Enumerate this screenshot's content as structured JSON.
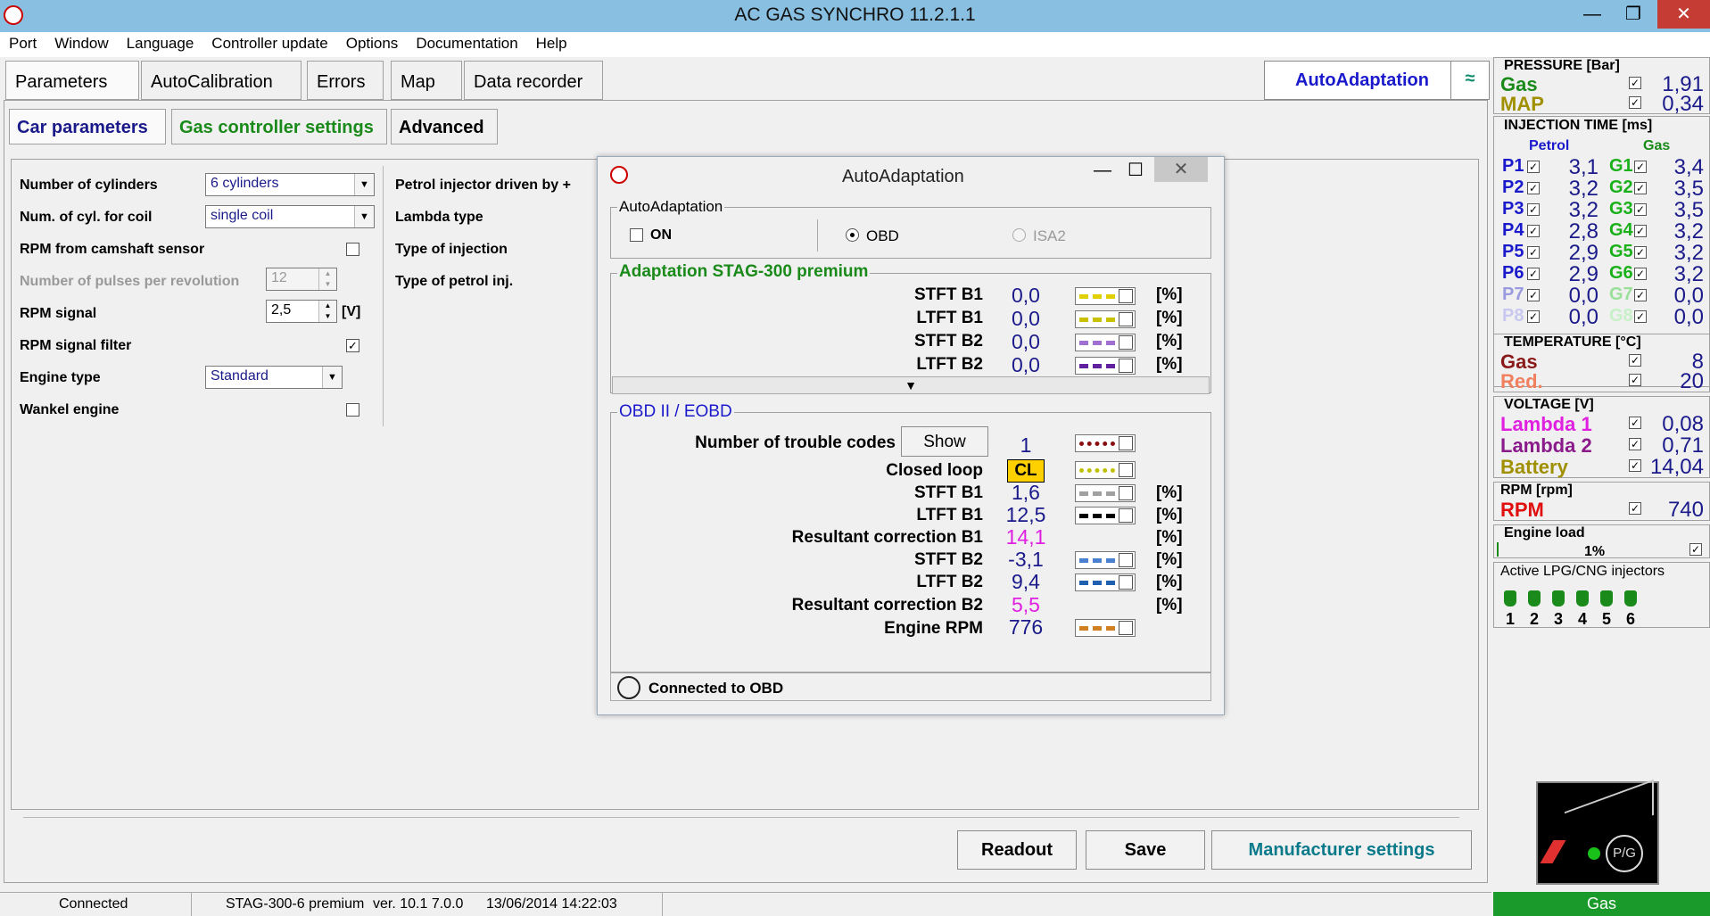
{
  "app": {
    "title": "AC GAS SYNCHRO  11.2.1.1"
  },
  "menu": [
    "Port",
    "Window",
    "Language",
    "Controller update",
    "Options",
    "Documentation",
    "Help"
  ],
  "tabs": [
    "Parameters",
    "AutoCalibration",
    "Errors",
    "Map",
    "Data recorder"
  ],
  "autoadapt_button": "AutoAdaptation",
  "subtabs": [
    "Car parameters",
    "Gas controller settings",
    "Advanced"
  ],
  "car": {
    "num_cyl_label": "Number of cylinders",
    "num_cyl_value": "6 cylinders",
    "coil_label": "Num. of cyl. for coil",
    "coil_value": "single coil",
    "camshaft_label": "RPM from camshaft sensor",
    "pulses_label": "Number of pulses per revolution",
    "pulses_value": "12",
    "rpm_signal_label": "RPM signal",
    "rpm_signal_value": "2,5",
    "rpm_signal_unit": "[V]",
    "filter_label": "RPM signal filter",
    "engine_type_label": "Engine type",
    "engine_type_value": "Standard",
    "wankel_label": "Wankel engine",
    "petrol_driven_label": "Petrol injector driven by +",
    "lambda_type_label": "Lambda type",
    "injection_type_label": "Type of injection",
    "petrol_inj_label": "Type of petrol inj."
  },
  "dialog": {
    "title": "AutoAdaptation",
    "group1": "AutoAdaptation",
    "on": "ON",
    "obd": "OBD",
    "isa2": "ISA2",
    "group2": "Adaptation STAG-300 premium",
    "adapt_rows": [
      {
        "label": "STFT B1",
        "value": "0,0",
        "unit": "[%]",
        "color": "#e0d000"
      },
      {
        "label": "LTFT B1",
        "value": "0,0",
        "unit": "[%]",
        "color": "#c8c000"
      },
      {
        "label": "STFT B2",
        "value": "0,0",
        "unit": "[%]",
        "color": "#a070d0"
      },
      {
        "label": "LTFT B2",
        "value": "0,0",
        "unit": "[%]",
        "color": "#6020a0"
      }
    ],
    "group3": "OBD II / EOBD",
    "trouble_label": "Number of trouble codes",
    "show_button": "Show",
    "trouble_value": "1",
    "closed_loop_label": "Closed loop",
    "closed_loop_value": "CL",
    "obd_rows": [
      {
        "label": "STFT B1",
        "value": "1,6",
        "unit": "[%]",
        "color": "#a0a0a0"
      },
      {
        "label": "LTFT B1",
        "value": "12,5",
        "unit": "[%]",
        "color": "#000000"
      },
      {
        "label": "Resultant correction B1",
        "value": "14,1",
        "unit": "[%]",
        "color": ""
      },
      {
        "label": "STFT B2",
        "value": "-3,1",
        "unit": "[%]",
        "color": "#4a80d0"
      },
      {
        "label": "LTFT B2",
        "value": "9,4",
        "unit": "[%]",
        "color": "#2060b0"
      },
      {
        "label": "Resultant correction B2",
        "value": "5,5",
        "unit": "[%]",
        "color": ""
      },
      {
        "label": "Engine RPM",
        "value": "776",
        "unit": "",
        "color": "#d08020"
      }
    ],
    "connected": "Connected to OBD"
  },
  "buttons": {
    "readout": "Readout",
    "save": "Save",
    "manufacturer": "Manufacturer settings"
  },
  "status": {
    "connected": "Connected",
    "device": "STAG-300-6 premium",
    "version": "ver. 10.1  7.0.0",
    "date": "13/06/2014 14:22:03"
  },
  "right": {
    "pressure_header": "PRESSURE [Bar]",
    "gas_label": "Gas",
    "gas_value": "1,91",
    "map_label": "MAP",
    "map_value": "0,34",
    "inj_header": "INJECTION TIME [ms]",
    "petrol_header": "Petrol",
    "gas_header": "Gas",
    "inj_rows": [
      {
        "p": "P1",
        "pv": "3,1",
        "g": "G1",
        "gv": "3,4"
      },
      {
        "p": "P2",
        "pv": "3,2",
        "g": "G2",
        "gv": "3,5"
      },
      {
        "p": "P3",
        "pv": "3,2",
        "g": "G3",
        "gv": "3,5"
      },
      {
        "p": "P4",
        "pv": "2,8",
        "g": "G4",
        "gv": "3,2"
      },
      {
        "p": "P5",
        "pv": "2,9",
        "g": "G5",
        "gv": "3,2"
      },
      {
        "p": "P6",
        "pv": "2,9",
        "g": "G6",
        "gv": "3,2"
      },
      {
        "p": "P7",
        "pv": "0,0",
        "g": "G7",
        "gv": "0,0"
      },
      {
        "p": "P8",
        "pv": "0,0",
        "g": "G8",
        "gv": "0,0"
      }
    ],
    "temp_header": "TEMPERATURE [°C]",
    "temp_gas_label": "Gas",
    "temp_gas_value": "8",
    "temp_red_label": "Red.",
    "temp_red_value": "20",
    "volt_header": "VOLTAGE [V]",
    "lambda1_label": "Lambda 1",
    "lambda1_value": "0,08",
    "lambda2_label": "Lambda 2",
    "lambda2_value": "0,71",
    "battery_label": "Battery",
    "battery_value": "14,04",
    "rpm_header": "RPM [rpm]",
    "rpm_label": "RPM",
    "rpm_value": "740",
    "load_header": "Engine load",
    "load_value": "1%",
    "injectors_header": "Active LPG/CNG injectors",
    "injectors": [
      "1",
      "2",
      "3",
      "4",
      "5",
      "6"
    ],
    "pg_label": "P/G",
    "fuel_status": "Gas"
  }
}
